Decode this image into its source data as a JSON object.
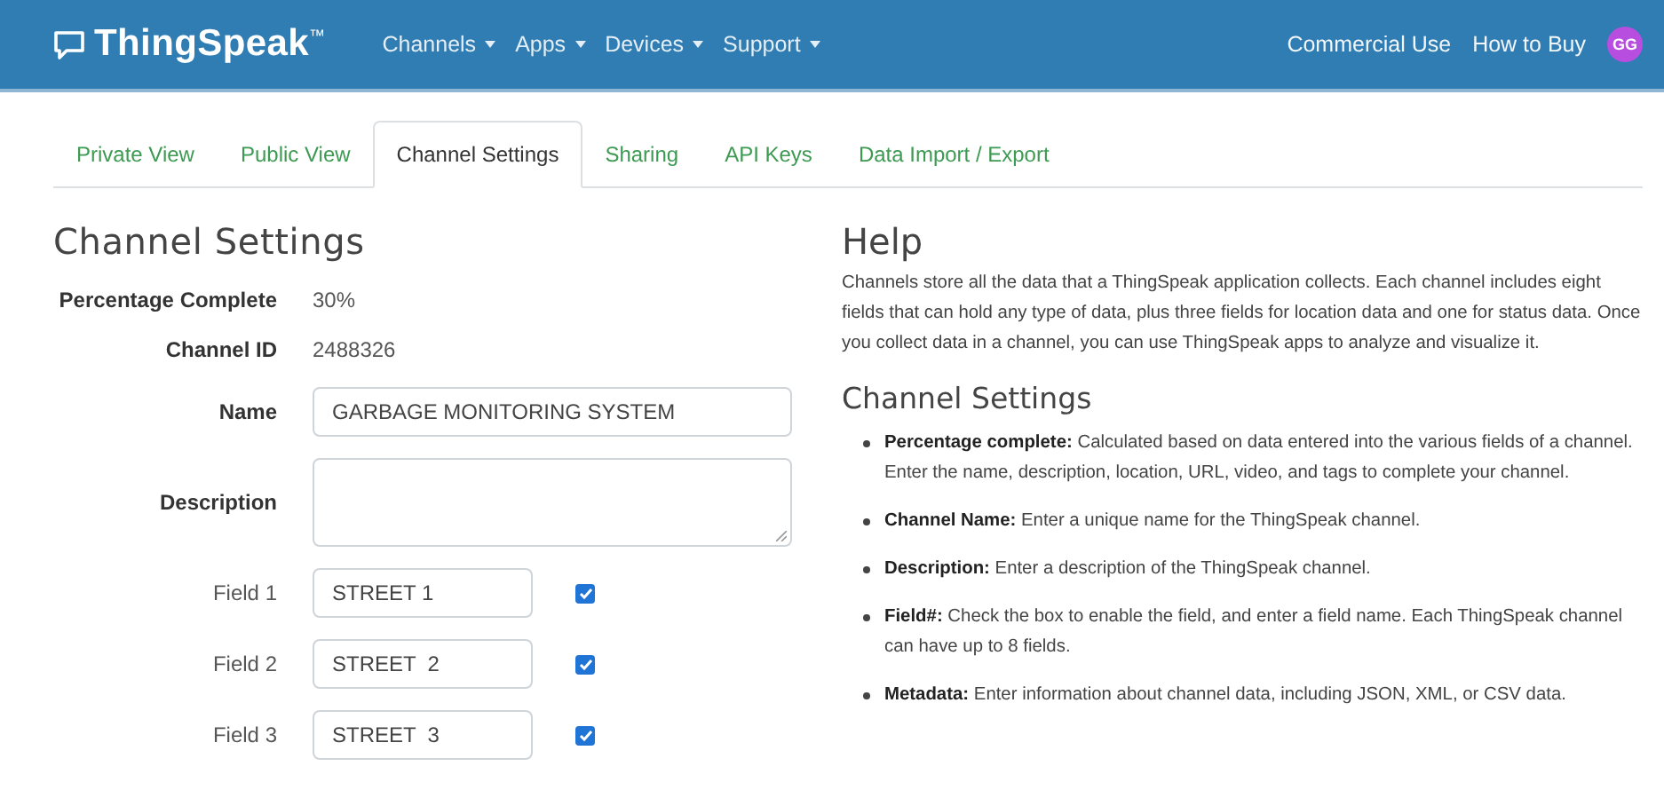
{
  "navbar": {
    "logo": "ThingSpeak$^{™}$",
    "menus": [
      {
        "label": "Channels",
        "dropdown": true
      },
      {
        "label": "Apps",
        "dropdown": true
      },
      {
        "label": "Devices",
        "dropdown": true
      },
      {
        "label": "Support",
        "dropdown": true
      }
    ],
    "links": [
      "Commercial Use",
      "How to Buy"
    ],
    "avatar": {
      "initials": "GG",
      "color": "#b84ee0"
    }
  },
  "tabs": [
    {
      "label": "Private View",
      "selected": false
    },
    {
      "label": "Public View",
      "selected": false
    },
    {
      "label": "Channel Settings",
      "selected": true
    },
    {
      "label": "Sharing",
      "selected": false
    },
    {
      "label": "API Keys",
      "selected": false
    },
    {
      "label": "Data Import / Export",
      "selected": false
    }
  ],
  "settings": {
    "title": "Channel Settings",
    "rows": [
      {
        "kind": "text",
        "label": "Percentage Complete",
        "value": "30%"
      },
      {
        "kind": "text",
        "label": "Channel ID",
        "value": "2488326"
      },
      {
        "kind": "input",
        "label": "Name",
        "value": "GARBAGE MONITORING SYSTEM"
      },
      {
        "kind": "textarea",
        "label": "Description"
      },
      {
        "kind": "field",
        "label": "Field 1",
        "value": "STREET 1",
        "checked": true
      },
      {
        "kind": "field",
        "label": "Field 2",
        "value": "STREET  2",
        "checked": true
      },
      {
        "kind": "field",
        "label": "Field 3",
        "value": "STREET  3",
        "checked": true
      }
    ]
  },
  "help": {
    "title": "Help",
    "intro": "Channels store all the data that a ThingSpeak application collects. Each channel includes eight fields that can hold any type of data, plus three fields for location data and one for status data. Once you collect data in a channel, you can use ThingSpeak apps to analyze and visualize it.",
    "subtitle": "Channel Settings",
    "items": [
      "**Percentage complete:** Calculated based on data entered into the various fields of a channel. Enter the name, description, location, URL, video, and tags to complete your channel.",
      "**Channel Name:** Enter a unique name for the ThingSpeak channel.",
      "**Description:** Enter a description of the ThingSpeak channel.",
      "**Field#:** Check the box to enable the field, and enter a field name. Each ThingSpeak channel can have up to 8 fields.",
      "**Metadata:** Enter information about channel data, including JSON, XML, or CSV data."
    ]
  }
}
